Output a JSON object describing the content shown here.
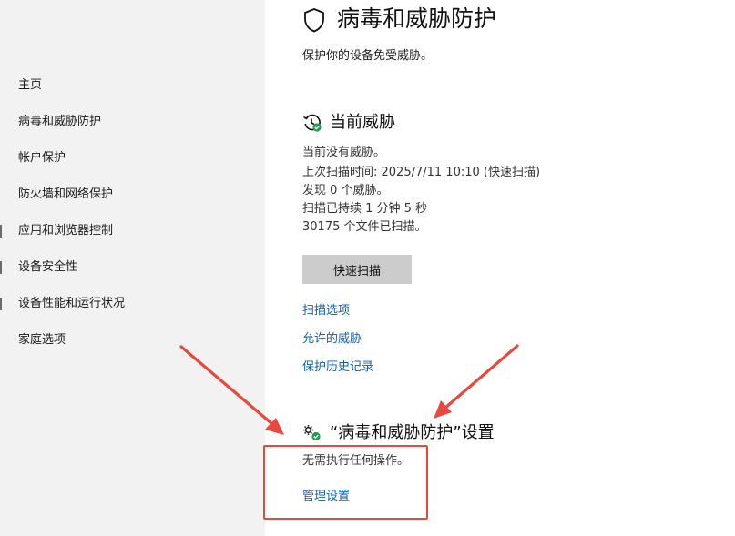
{
  "sidebar": {
    "items": [
      {
        "label": "主页"
      },
      {
        "label": "病毒和威胁防护"
      },
      {
        "label": "帐户保护"
      },
      {
        "label": "防火墙和网络保护"
      },
      {
        "label": "应用和浏览器控制"
      },
      {
        "label": "设备安全性"
      },
      {
        "label": "设备性能和运行状况"
      },
      {
        "label": "家庭选项"
      }
    ]
  },
  "header": {
    "icon": "shield-icon",
    "title": "病毒和威胁防护",
    "subtitle": "保护你的设备免受威胁。"
  },
  "current_threats": {
    "icon": "history-check-icon",
    "title": "当前威胁",
    "status": "当前没有威胁。",
    "last_scan": "上次扫描时间: 2025/7/11 10:10 (快速扫描)",
    "found": "发现 0 个威胁。",
    "duration": "扫描已持续 1 分钟 5 秒",
    "files_scanned": "30175 个文件已扫描。",
    "quick_scan_label": "快速扫描",
    "links": [
      "扫描选项",
      "允许的威胁",
      "保护历史记录"
    ]
  },
  "settings_section": {
    "icon": "gear-check-icon",
    "title": "“病毒和威胁防护”设置",
    "status": "无需执行任何操作。",
    "manage_link": "管理设置"
  },
  "colors": {
    "sidebar_bg": "#f2f2f2",
    "link": "#0b62b8",
    "button_bg": "#cccccc",
    "annotation": "#e8483d",
    "ok_green": "#16a34a"
  }
}
